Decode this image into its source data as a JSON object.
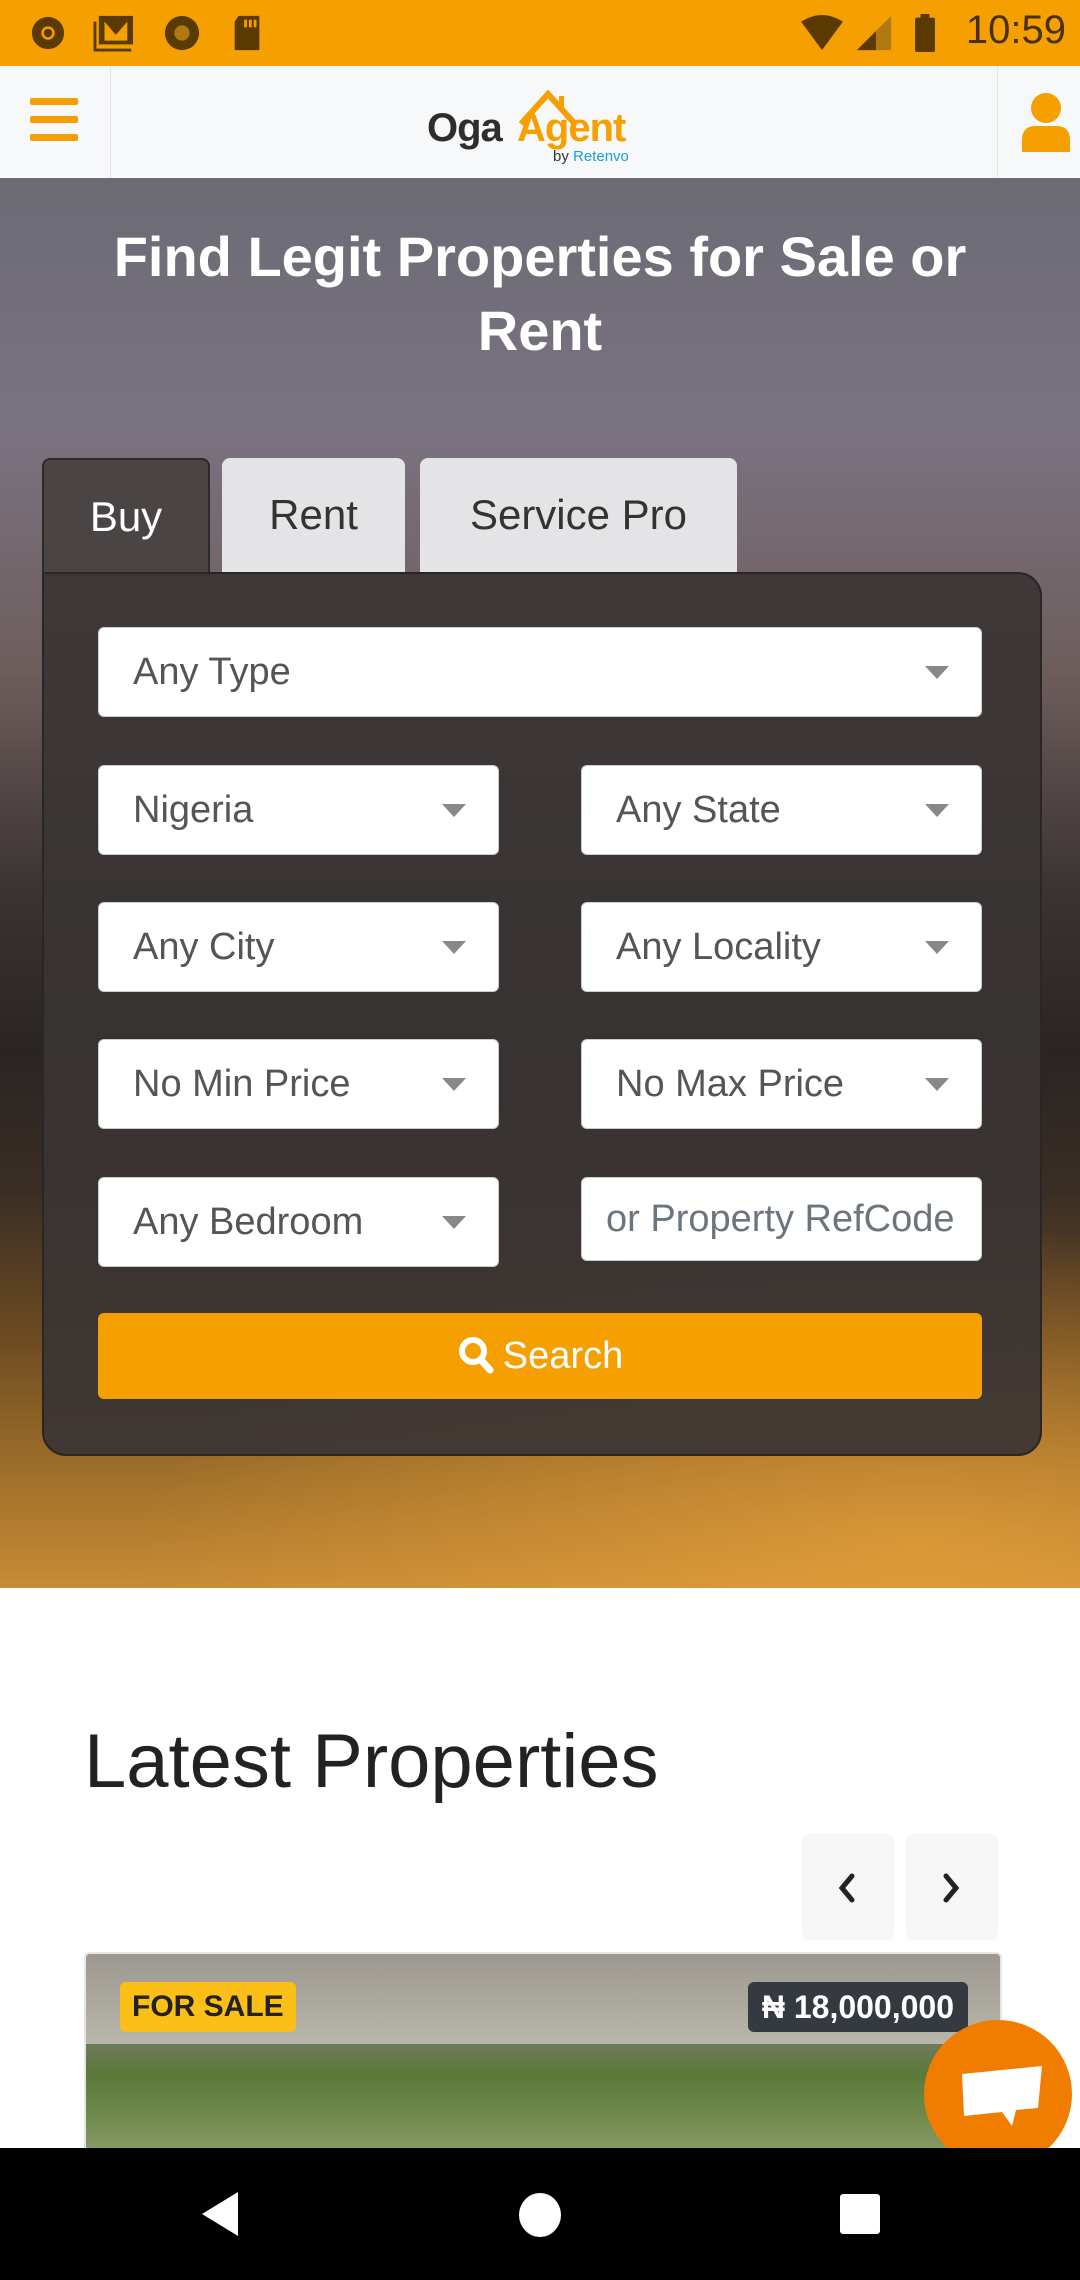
{
  "status_bar": {
    "time": "10:59",
    "left_icons": [
      "chrome-icon",
      "gmail-icon",
      "record-icon",
      "sd-card-icon"
    ],
    "right_icons": [
      "wifi-icon",
      "signal-icon",
      "battery-icon"
    ]
  },
  "header": {
    "logo_primary": "Oga",
    "logo_secondary": "Agent",
    "logo_by": "by",
    "logo_brand": "Retenvo",
    "menu_icon": "hamburger-icon",
    "user_icon": "user-icon"
  },
  "hero": {
    "title": "Find Legit Properties for Sale or Rent"
  },
  "search": {
    "tabs": [
      {
        "label": "Buy",
        "active": true
      },
      {
        "label": "Rent",
        "active": false
      },
      {
        "label": "Service Pro",
        "active": false
      }
    ],
    "type_select": "Any Type",
    "country_select": "Nigeria",
    "state_select": "Any State",
    "city_select": "Any City",
    "locality_select": "Any Locality",
    "min_price_select": "No Min Price",
    "max_price_select": "No Max Price",
    "bedroom_select": "Any Bedroom",
    "refcode_placeholder": "or Property RefCode",
    "search_button": "Search"
  },
  "latest": {
    "title": "Latest Properties",
    "properties": [
      {
        "badge": "FOR SALE",
        "price": "₦ 18,000,000"
      }
    ]
  },
  "colors": {
    "brand": "#f5a000",
    "chat_fab": "#f07d00",
    "sale_badge": "#fbbf17",
    "price_badge": "#343a40"
  }
}
